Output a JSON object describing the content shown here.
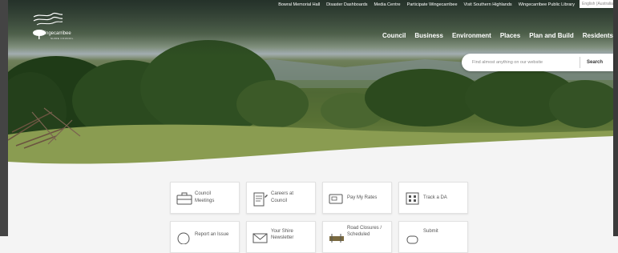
{
  "utility_nav": [
    "Bowral Memorial Hall",
    "Disaster Dashboards",
    "Media Centre",
    "Participate Wingecarribee",
    "Visit Southern Highlands",
    "Wingecarribee Public Library"
  ],
  "language": "English (Australia)",
  "logo": {
    "name": "Wingecarribee",
    "subtitle": "SHIRE COUNCIL"
  },
  "main_nav": [
    "Council",
    "Business",
    "Environment",
    "Places",
    "Plan and Build",
    "Residents"
  ],
  "search": {
    "placeholder": "Find almost anything on our website",
    "button": "Search"
  },
  "quick_links": [
    {
      "line1": "Council",
      "line2": "Meetings",
      "icon": "briefcase-icon"
    },
    {
      "line1": "Careers at",
      "line2": "Council",
      "icon": "document-icon"
    },
    {
      "line1": "Pay My Rates",
      "line2": "",
      "icon": "payment-icon"
    },
    {
      "line1": "Track a DA",
      "line2": "",
      "icon": "building-icon"
    },
    {
      "line1": "Report an Issue",
      "line2": "",
      "icon": "info-icon"
    },
    {
      "line1": "Your Shire",
      "line2": "Newsletter",
      "icon": "envelope-icon"
    },
    {
      "line1": "Road Closures /",
      "line2": "Scheduled",
      "icon": "road-icon"
    },
    {
      "line1": "Submit",
      "line2": "",
      "icon": "form-icon"
    }
  ]
}
